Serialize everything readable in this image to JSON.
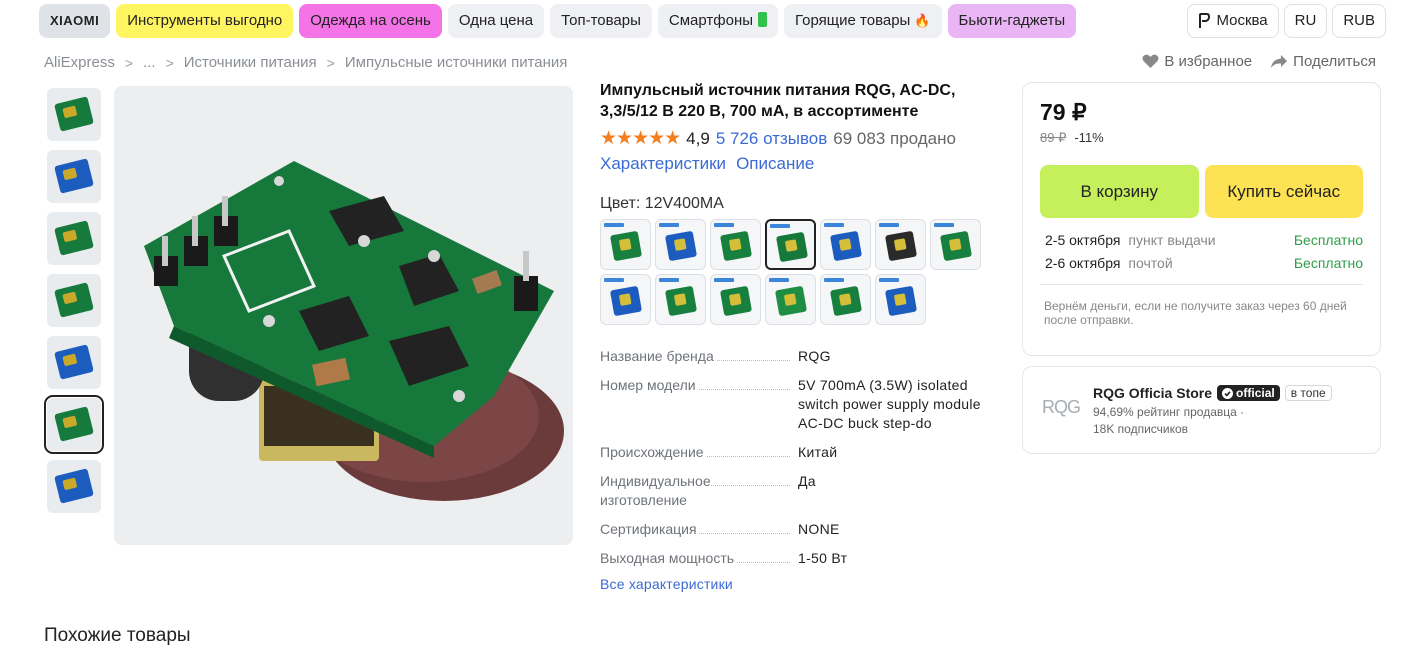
{
  "top_tags": [
    {
      "label": "XIAOMI"
    },
    {
      "label": "Инструменты выгодно"
    },
    {
      "label": "Одежда на осень"
    },
    {
      "label": "Одна цена"
    },
    {
      "label": "Топ-товары"
    },
    {
      "label": "Смартфоны"
    },
    {
      "label": "Горящие товары"
    },
    {
      "label": "Бьюти-гаджеты"
    }
  ],
  "top_right": {
    "location": "Москва",
    "language": "RU",
    "currency": "RUB"
  },
  "breadcrumb": [
    "AliExpress",
    "...",
    "Источники питания",
    "Импульсные источники питания"
  ],
  "actions": {
    "favorite": "В избранное",
    "share": "Поделиться"
  },
  "product": {
    "title": "Импульсный источник питания RQG, AC-DC, 3,3/5/12 В 220 В, 700 мА, в ассортименте",
    "stars": "★★★★★",
    "rating": "4,9",
    "reviews": "5 726 отзывов",
    "sold": "69 083 продано",
    "link_specs": "Характеристики",
    "link_description": "Описание",
    "color_label": "Цвет: 12V400MA"
  },
  "specs": [
    {
      "key": "Название бренда",
      "value": "RQG"
    },
    {
      "key": "Номер модели",
      "value": "5V 700mA (3.5W) isolated switch power supply module AC-DC buck step-do"
    },
    {
      "key": "Происхождение",
      "value": "Китай"
    },
    {
      "key": "Индивидуальное изготовление",
      "value": "Да"
    },
    {
      "key": "Сертификация",
      "value": "NONE"
    },
    {
      "key": "Выходная мощность",
      "value": "1-50 Вт"
    }
  ],
  "all_specs": "Все характеристики",
  "buy_box": {
    "price": "79 ₽",
    "old_price": "89 ₽",
    "discount": "-11%",
    "add_to_cart": "В корзину",
    "buy_now": "Купить сейчас",
    "delivery": [
      {
        "date": "2-5 октября",
        "method": "пункт выдачи",
        "cost": "Бесплатно"
      },
      {
        "date": "2-6 октября",
        "method": "почтой",
        "cost": "Бесплатно"
      }
    ],
    "refund": "Вернём деньги, если не получите заказ через 60 дней после отправки."
  },
  "store": {
    "logo_text": "RQG",
    "name": "RQG Officia Store",
    "official": "official",
    "badge": "в топе",
    "rating": "94,69% рейтинг продавца ·",
    "subscribers": "18K подписчиков"
  },
  "similar_title": "Похожие товары",
  "colors": {
    "accent_link": "#3a6ad6",
    "cart_button": "#c5f05c",
    "buy_button": "#fde354",
    "free_delivery": "#2e9e4a",
    "stars": "#f57e1f",
    "pcb_green": "#157a3b"
  }
}
